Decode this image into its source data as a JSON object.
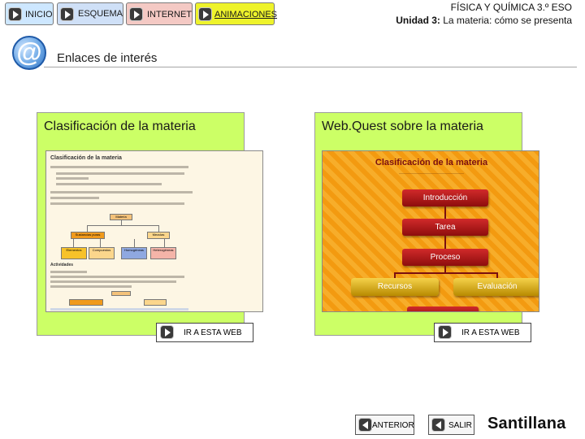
{
  "nav": {
    "tabs": [
      {
        "label": "INICIO"
      },
      {
        "label": "ESQUEMA"
      },
      {
        "label": "INTERNET"
      },
      {
        "label": "ANIMACIONES"
      }
    ]
  },
  "header": {
    "course": "FÍSICA Y QUÍMICA 3.º ESO",
    "unit_prefix": "Unidad 3:",
    "unit_title": "La materia: cómo se presenta"
  },
  "section": {
    "title": "Enlaces de interés",
    "icon": "at-sign-icon"
  },
  "cards": [
    {
      "title": "Clasificación de la materia",
      "button_label": "IR A ESTA WEB",
      "preview": {
        "heading": "Clasificación de la materia",
        "nodes": [
          "Materia",
          "Sustancias puras",
          "Mezclas",
          "Elementos",
          "Compuestos",
          "Homogéneas",
          "Heterogéneas"
        ],
        "activities_label": "Actividades"
      }
    },
    {
      "title": "Web.Quest sobre la materia",
      "button_label": "IR A ESTA WEB",
      "preview": {
        "heading": "Clasificación de la materia",
        "menu": [
          "Introducción",
          "Tarea",
          "Proceso",
          "Recursos",
          "Evaluación"
        ]
      }
    }
  ],
  "footer": {
    "prev_label": "ANTERIOR",
    "exit_label": "SALIR",
    "brand": "Santillana"
  },
  "colors": {
    "card_bg": "#ccff66",
    "nav_inicio": "#cde7ff",
    "nav_esquema": "#cfe0f7",
    "nav_internet": "#f4c9c4",
    "nav_animaciones": "#eef32b"
  }
}
